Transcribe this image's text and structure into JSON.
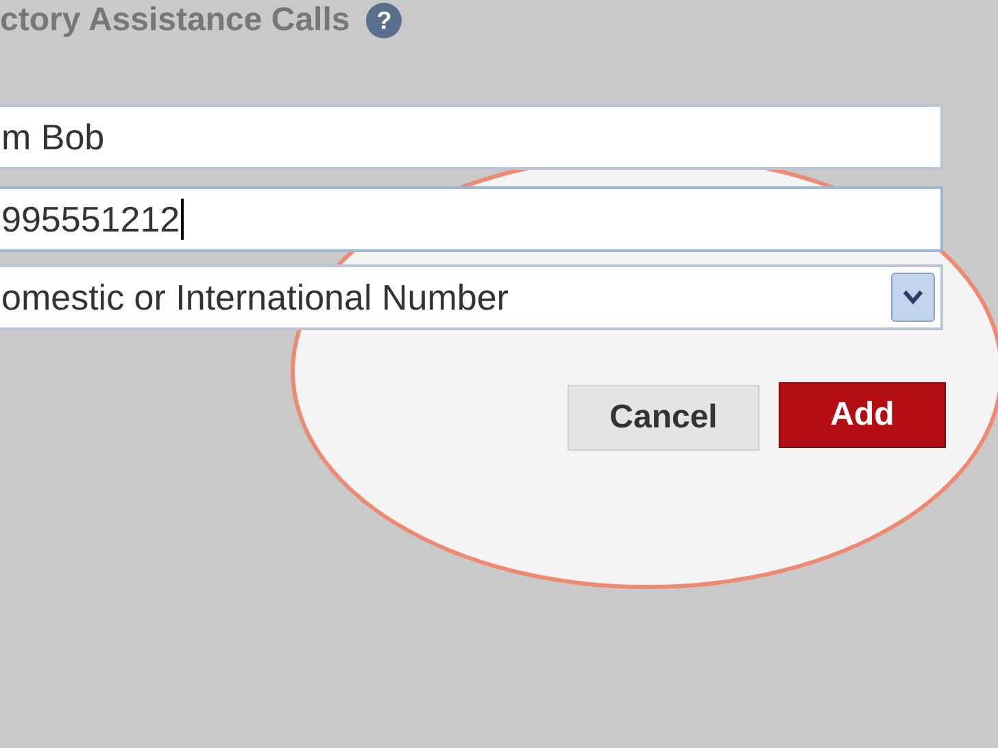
{
  "section": {
    "title": "ctory Assistance Calls",
    "help_icon": "?"
  },
  "fields": [
    {
      "value": "m Bob",
      "focused": false
    },
    {
      "value": "995551212",
      "focused": true
    }
  ],
  "select": {
    "value": "omestic or International Number"
  },
  "buttons": [
    {
      "label": "Cancel",
      "kind": "secondary"
    },
    {
      "label": "Add",
      "kind": "primary"
    }
  ]
}
